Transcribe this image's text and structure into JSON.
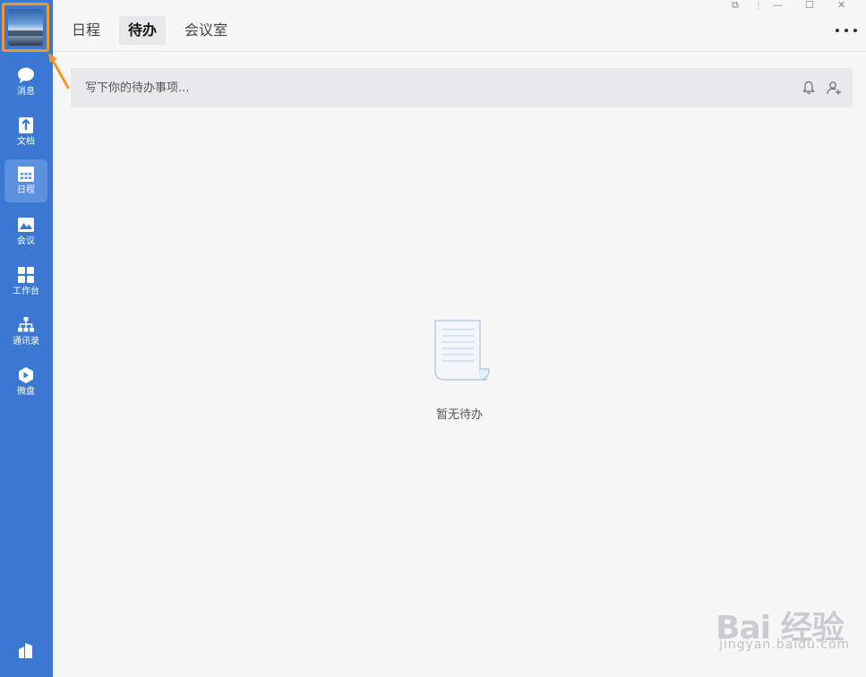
{
  "sidebar": {
    "items": [
      {
        "label": "消息",
        "icon": "chat-bubble-icon"
      },
      {
        "label": "文档",
        "icon": "document-icon"
      },
      {
        "label": "日程",
        "icon": "calendar-icon",
        "active": true
      },
      {
        "label": "会议",
        "icon": "meeting-icon"
      },
      {
        "label": "工作台",
        "icon": "workbench-grid-icon"
      },
      {
        "label": "通讯录",
        "icon": "org-chart-icon"
      },
      {
        "label": "微盘",
        "icon": "cloud-drive-icon"
      }
    ]
  },
  "header": {
    "tabs": [
      {
        "label": "日程"
      },
      {
        "label": "待办",
        "active": true
      },
      {
        "label": "会议室"
      }
    ]
  },
  "todo": {
    "placeholder": "写下你的待办事项..."
  },
  "empty": {
    "text": "暂无待办"
  },
  "watermark": {
    "logo": "Bai 经验",
    "url": "jingyan.baidu.com"
  },
  "colors": {
    "sidebar": "#3a78d2",
    "highlight": "#f5962a",
    "background": "#f7f7f8"
  }
}
